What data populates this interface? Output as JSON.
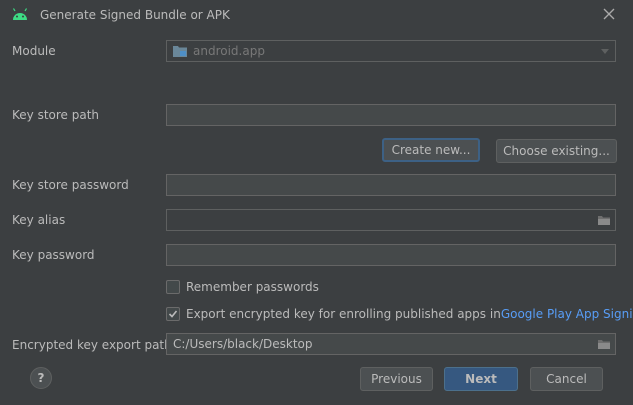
{
  "window": {
    "title": "Generate Signed Bundle or APK",
    "title_icon": "android-icon",
    "close_icon": "close-icon"
  },
  "module": {
    "label": "Module",
    "value": "android.app",
    "icon": "module-folder-icon"
  },
  "key_store_path": {
    "label": "Key store path",
    "value": ""
  },
  "buttons": {
    "create_new": "Create new...",
    "choose_existing": "Choose existing...",
    "previous": "Previous",
    "next": "Next",
    "cancel": "Cancel",
    "help": "?"
  },
  "key_store_password": {
    "label": "Key store password",
    "value": ""
  },
  "key_alias": {
    "label": "Key alias",
    "value": ""
  },
  "key_password": {
    "label": "Key password",
    "value": ""
  },
  "remember_passwords": {
    "label": "Remember passwords",
    "checked": false
  },
  "export_encrypted": {
    "label": "Export encrypted key for enrolling published apps in",
    "link": "Google Play App Signing",
    "checked": true
  },
  "encrypted_key_export_path": {
    "label": "Encrypted key export path",
    "value": "C:/Users/black/Desktop"
  },
  "colors": {
    "background": "#3c3f41",
    "link": "#589df6",
    "android_green": "#3ddc84",
    "primary_button": "#365880"
  }
}
